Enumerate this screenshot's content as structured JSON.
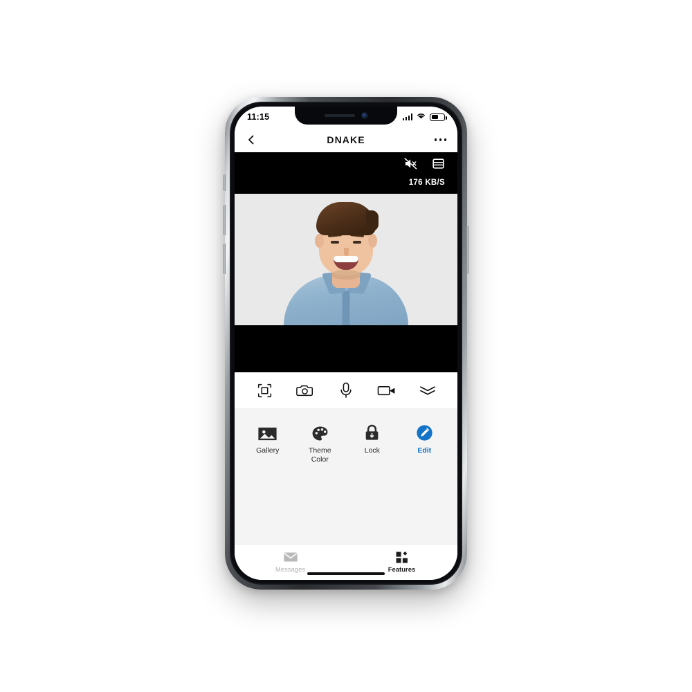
{
  "device": {
    "type": "smartphone-mockup",
    "frame_color": "#2a2d30"
  },
  "status_bar": {
    "time": "11:15",
    "signal_icon": "cellular-signal-icon",
    "wifi_icon": "wifi-icon",
    "battery_icon": "battery-icon"
  },
  "nav_bar": {
    "back_icon": "back-chevron-icon",
    "title": "DNAKE",
    "more_icon": "more-options-icon"
  },
  "video": {
    "mute_icon": "speaker-muted-icon",
    "layout_icon": "split-screen-icon",
    "bitrate": "176 KB/S",
    "subject": "smiling-man-in-denim-shirt"
  },
  "media_toolbar": {
    "buttons": [
      {
        "name": "snapshot-frame-button",
        "icon": "focus-frame-icon"
      },
      {
        "name": "camera-button",
        "icon": "camera-icon"
      },
      {
        "name": "microphone-button",
        "icon": "microphone-icon"
      },
      {
        "name": "video-record-button",
        "icon": "video-camera-icon"
      },
      {
        "name": "collapse-button",
        "icon": "double-chevron-down-icon"
      }
    ]
  },
  "features": {
    "items": [
      {
        "label": "Gallery",
        "icon": "gallery-icon",
        "active": false
      },
      {
        "label": "Theme\nColor",
        "label_line1": "Theme",
        "label_line2": "Color",
        "icon": "palette-icon",
        "active": false
      },
      {
        "label": "Lock",
        "icon": "lock-icon",
        "active": false
      },
      {
        "label": "Edit",
        "icon": "edit-pencil-icon",
        "active": true
      }
    ],
    "accent_color": "#1273C8"
  },
  "tab_bar": {
    "tabs": [
      {
        "label": "Messages",
        "icon": "envelope-icon",
        "active": false
      },
      {
        "label": "Features",
        "icon": "grid-icon",
        "active": true
      }
    ]
  }
}
